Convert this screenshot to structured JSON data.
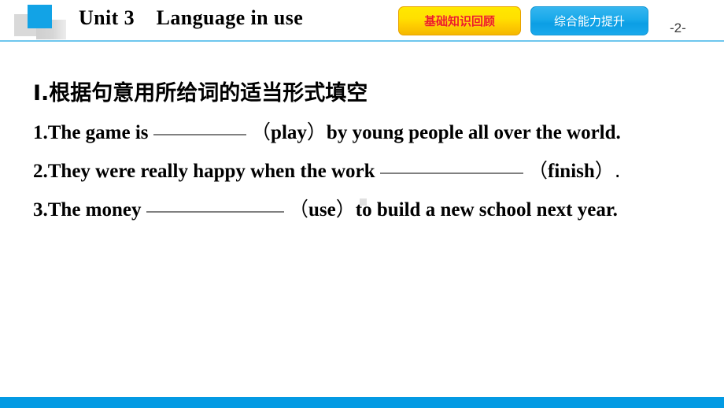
{
  "slide": {
    "page_number": "-2-",
    "accent_blue": "#039ae3",
    "logo_blue": "#12a3e6",
    "logo_gray": "#d9d9d9",
    "rule_blue": "#6ec6ee"
  },
  "header": {
    "title": "Unit 3    Language in use",
    "logo_name": "overlapping-squares-logo",
    "buttons": [
      {
        "label": "基础知识回顾",
        "bg": "#ffd900",
        "text_color": "#ee1c25",
        "border": "#e8a200"
      },
      {
        "label": "综合能力提升",
        "bg": "#19a9ea",
        "text_color": "#ffffff",
        "border": "#1498d6"
      }
    ]
  },
  "main": {
    "heading": "Ⅰ.根据句意用所给词的适当形式填空",
    "questions": [
      {
        "number": "1.",
        "part1": "The game is",
        "blank": "",
        "hint_open": "（",
        "hint": "play",
        "hint_close": "）",
        "part2": "by young people all over the world."
      },
      {
        "number": "2.",
        "part1": "They were really happy when the work",
        "blank": "",
        "hint_open": "（",
        "hint": "finish",
        "hint_close": "）.",
        "part2": ""
      },
      {
        "number": "3.",
        "part1": "The money",
        "blank": "",
        "hint_open": "（",
        "hint": "use",
        "hint_close": "）",
        "part2": "to build a new school next year."
      }
    ]
  }
}
